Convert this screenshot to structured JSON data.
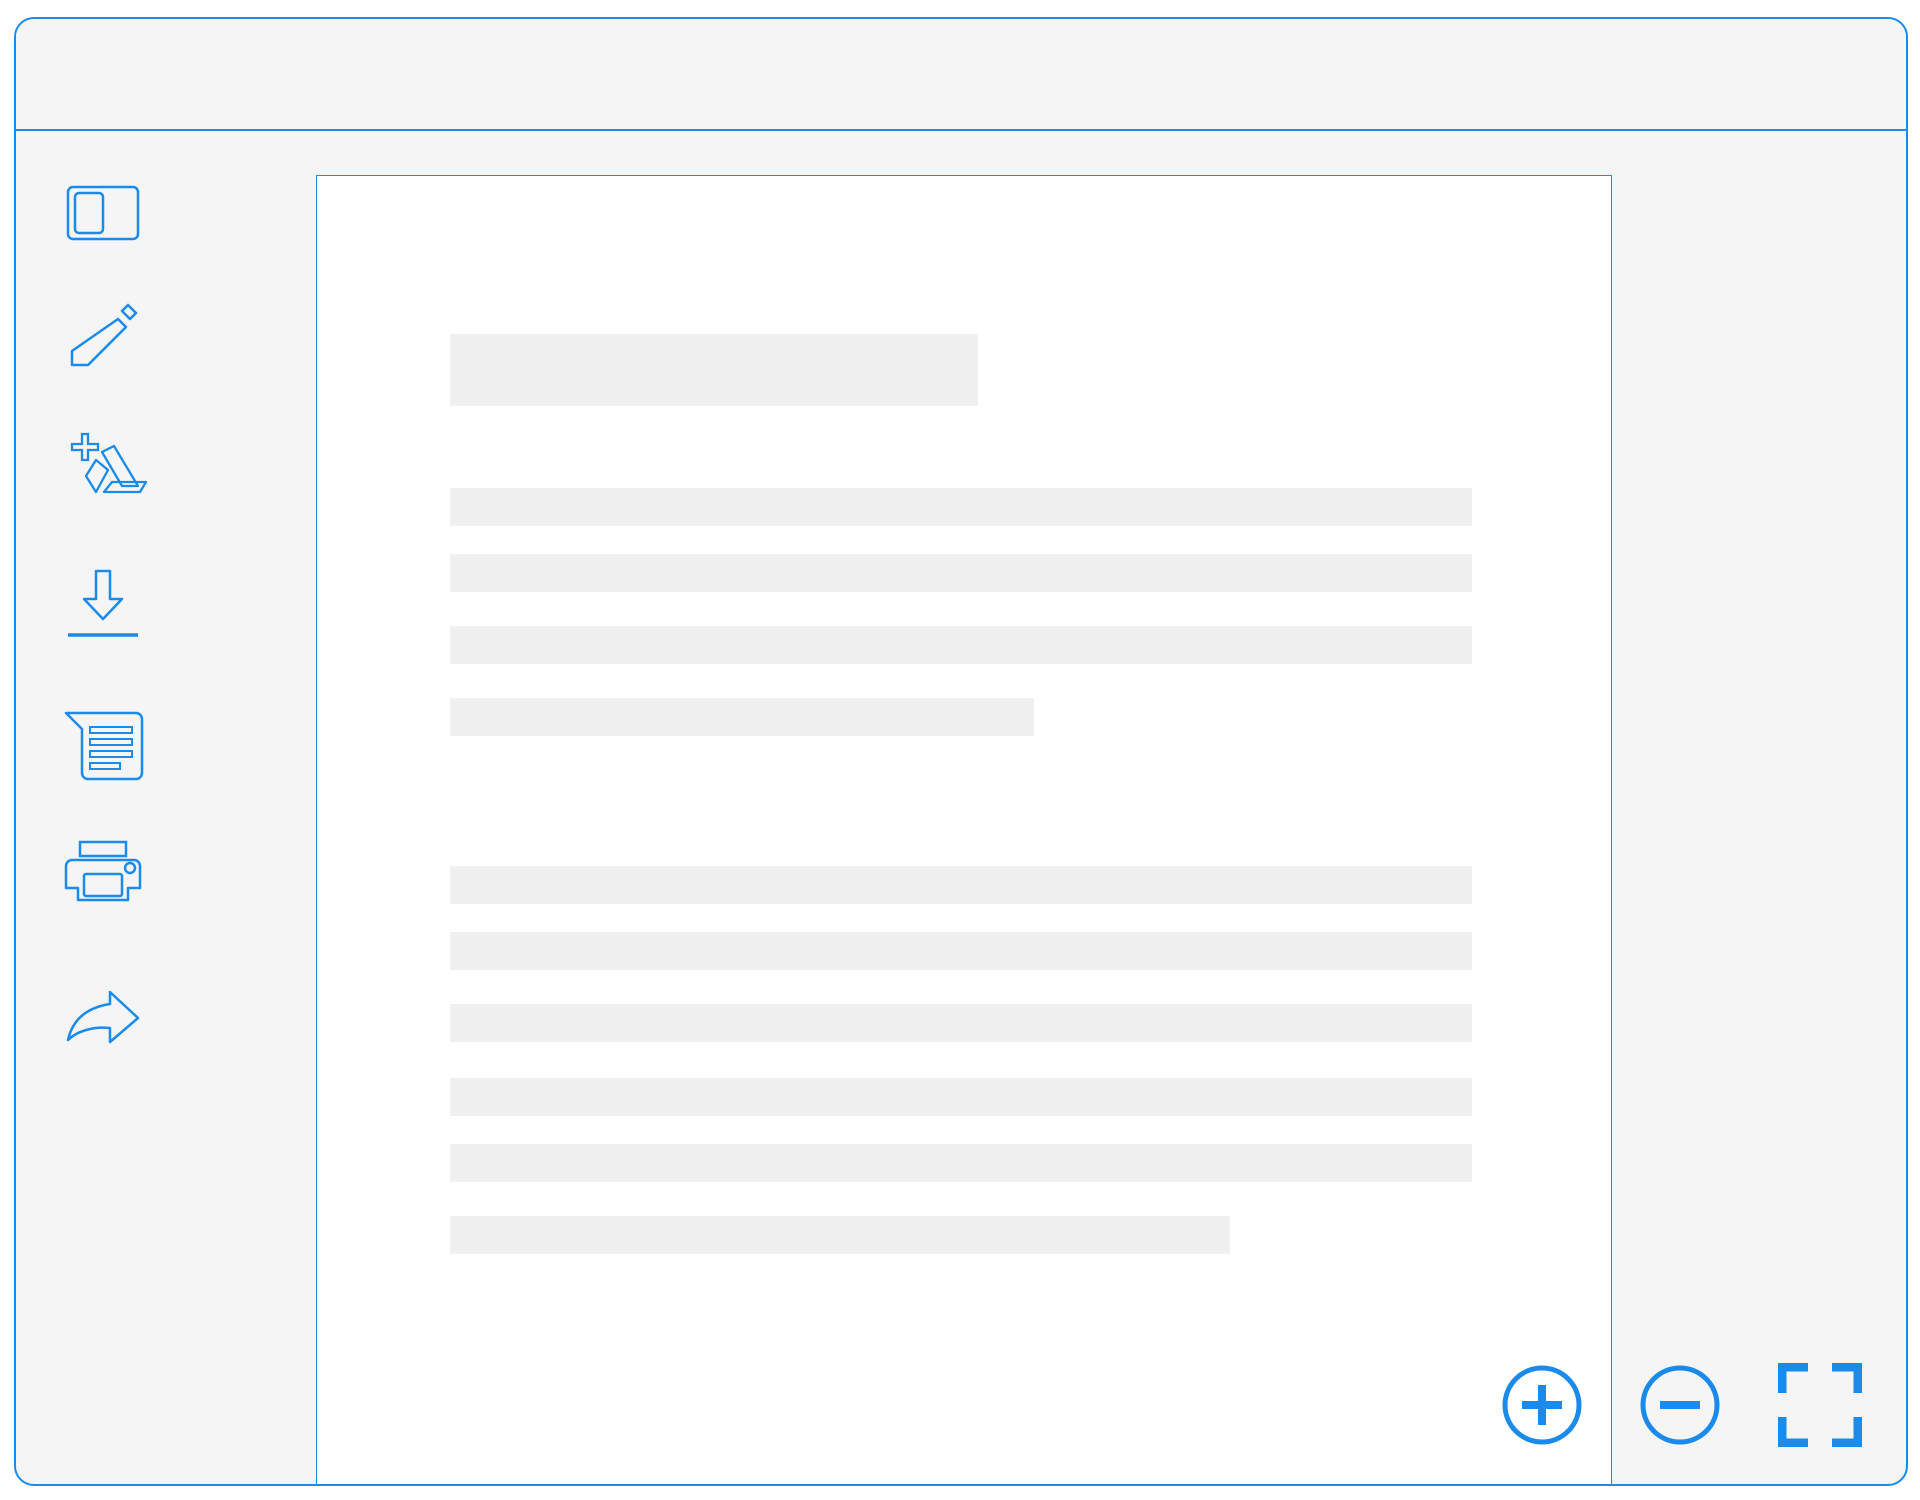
{
  "window": {
    "title": ""
  },
  "colors": {
    "accent": "#1a8aeb",
    "chrome": "#f5f5f5",
    "page": "#ffffff",
    "placeholder": "#f0f0f0"
  },
  "sidebar": {
    "items": [
      {
        "icon": "sidebar-toggle-icon"
      },
      {
        "icon": "pencil-icon"
      },
      {
        "icon": "add-to-drive-icon"
      },
      {
        "icon": "download-icon"
      },
      {
        "icon": "text-comment-icon"
      },
      {
        "icon": "printer-icon"
      },
      {
        "icon": "share-icon"
      }
    ]
  },
  "document": {
    "title_placeholder": true,
    "paragraphs": [
      {
        "lines": 4,
        "last_line_fraction": 0.57
      },
      {
        "lines": 6,
        "last_line_fraction": 0.76
      }
    ]
  },
  "zoom_controls": [
    {
      "icon": "zoom-in-icon"
    },
    {
      "icon": "zoom-out-icon"
    },
    {
      "icon": "fullscreen-icon"
    }
  ]
}
